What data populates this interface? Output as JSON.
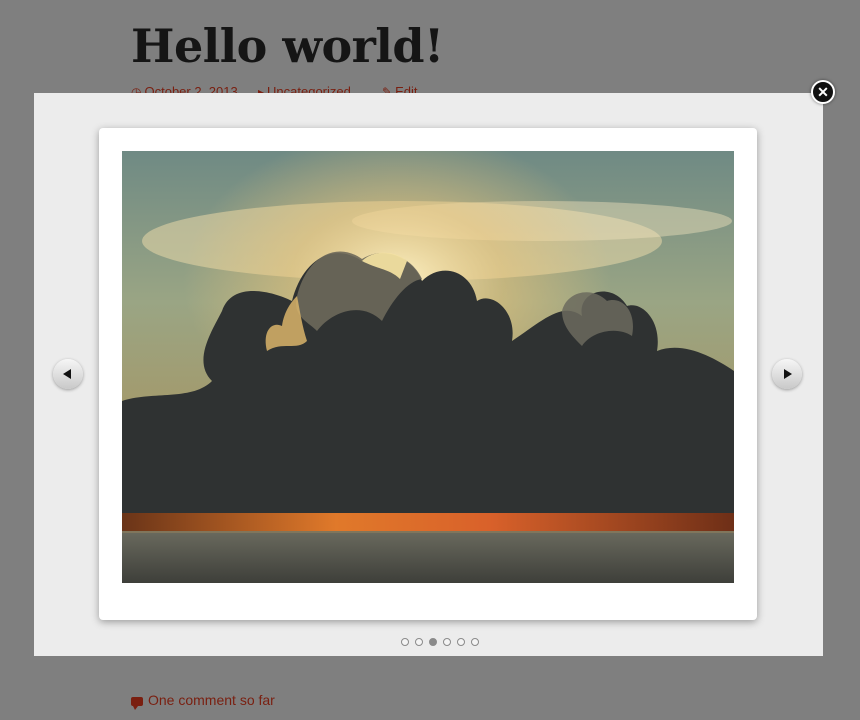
{
  "post": {
    "title": "Hello world!",
    "meta": {
      "date": "October 2, 2013",
      "category": "Uncategorized",
      "edit": "Edit"
    },
    "comments_link": "One comment so far"
  },
  "lightbox": {
    "image_subject": "sunset clouds over the sea",
    "slide_count": 6,
    "active_slide": 3,
    "icons": {
      "close": "close-icon",
      "previous": "chevron-left-icon",
      "next": "chevron-right-icon",
      "comment": "comment-bubble-icon",
      "date": "clock-icon",
      "category": "folder-icon",
      "edit": "pencil-icon"
    }
  },
  "colors": {
    "overlay": "#7f7f7f",
    "modal_background": "#ececec",
    "link": "#7a1f10",
    "title": "#151515"
  }
}
